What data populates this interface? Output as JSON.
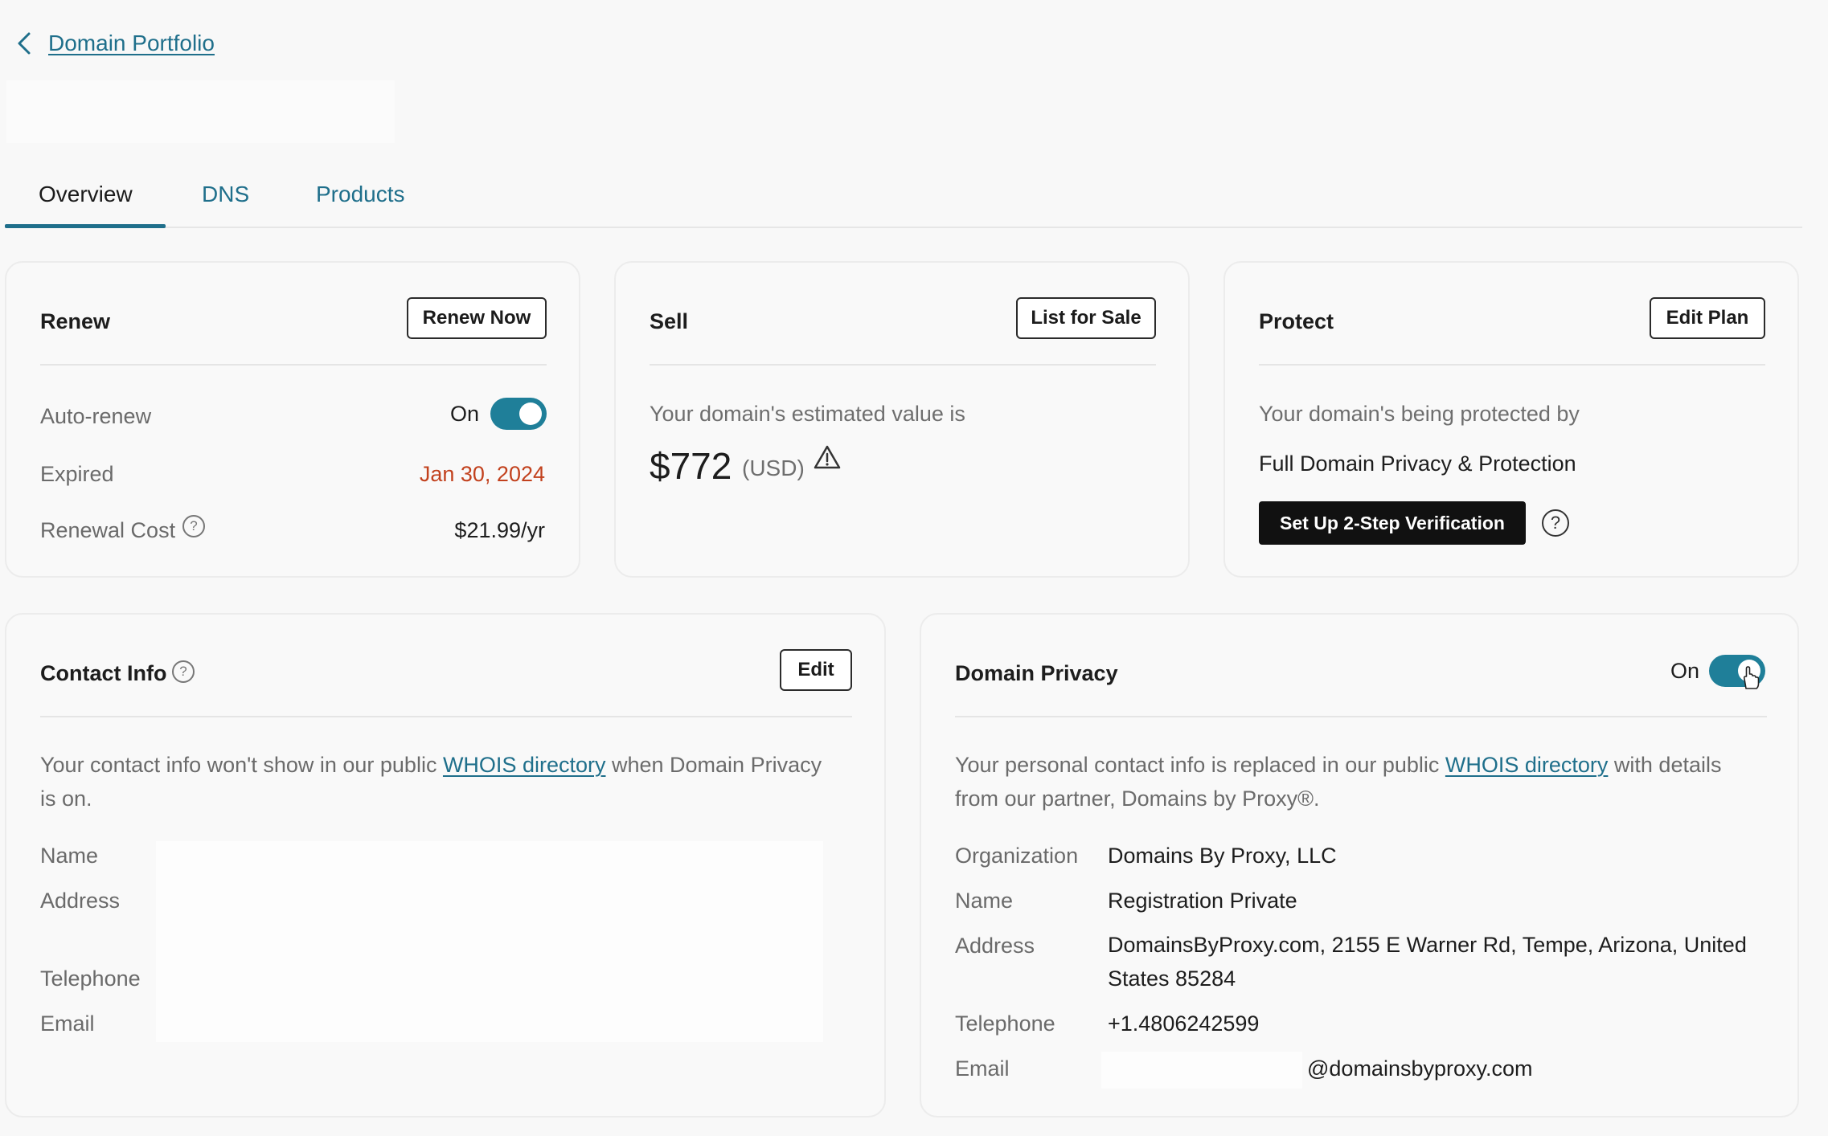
{
  "nav": {
    "back_label": "Domain Portfolio"
  },
  "tabs": [
    {
      "label": "Overview",
      "active": true
    },
    {
      "label": "DNS",
      "active": false
    },
    {
      "label": "Products",
      "active": false
    }
  ],
  "renew": {
    "title": "Renew",
    "button": "Renew Now",
    "auto_renew_label": "Auto-renew",
    "auto_renew_state": "On",
    "expired_label": "Expired",
    "expired_date": "Jan 30, 2024",
    "cost_label": "Renewal Cost",
    "cost_value": "$21.99/yr"
  },
  "sell": {
    "title": "Sell",
    "button": "List for Sale",
    "estimate_text": "Your domain's estimated value is",
    "value": "$772",
    "currency": "(USD)"
  },
  "protect": {
    "title": "Protect",
    "button": "Edit Plan",
    "protected_text": "Your domain's being protected by",
    "plan_name": "Full Domain Privacy & Protection",
    "cta": "Set Up 2-Step Verification"
  },
  "contact": {
    "title": "Contact Info",
    "button": "Edit",
    "desc_prefix": "Your contact info won't show in our public ",
    "desc_link": "WHOIS directory",
    "desc_suffix": " when Domain Privacy is on.",
    "fields": {
      "name": "Name",
      "address": "Address",
      "telephone": "Telephone",
      "email": "Email"
    }
  },
  "privacy": {
    "title": "Domain Privacy",
    "state": "On",
    "desc_prefix": "Your personal contact info is replaced in our public ",
    "desc_link": "WHOIS directory",
    "desc_suffix": " with details from our partner, Domains by Proxy®.",
    "rows": {
      "org_label": "Organization",
      "org_value": "Domains By Proxy, LLC",
      "name_label": "Name",
      "name_value": "Registration Private",
      "address_label": "Address",
      "address_value": "DomainsByProxy.com, 2155 E Warner Rd, Tempe, Arizona, United States 85284",
      "telephone_label": "Telephone",
      "telephone_value": "+1.4806242599",
      "email_label": "Email",
      "email_value": "@domainsbyproxy.com"
    }
  },
  "colors": {
    "accent": "#1f6f8b",
    "toggle": "#1f7f99",
    "expired": "#c2411d",
    "cta_bg": "#111111"
  }
}
